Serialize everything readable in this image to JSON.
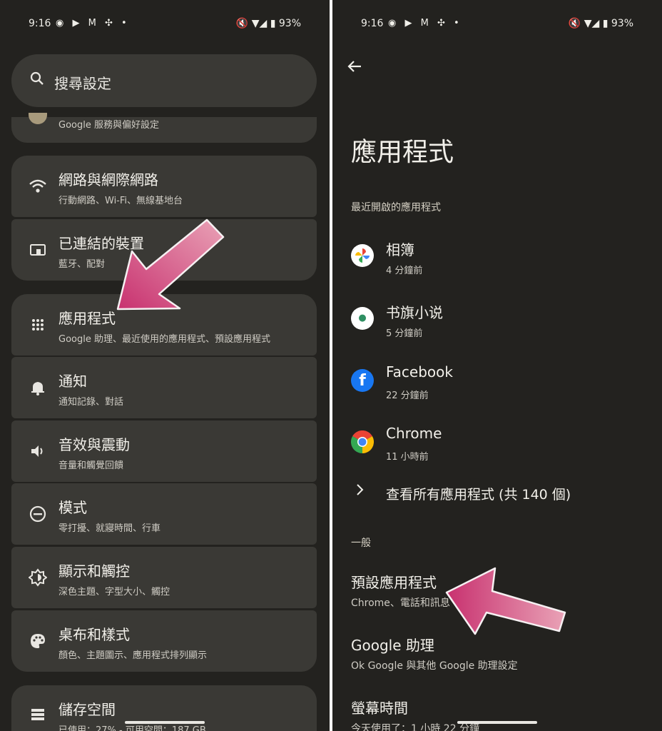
{
  "left": {
    "status": {
      "time": "9:16",
      "apps": "◉ ▶ M ✣ •",
      "system": "🔇 ▼◢ ▮ 93%"
    },
    "search": {
      "placeholder": "搜尋設定"
    },
    "partial_item": {
      "subtitle": "Google 服務與偏好設定"
    },
    "items": [
      {
        "title": "網路與網際網路",
        "subtitle": "行動網路、Wi-Fi、無線基地台",
        "icon": "wifi-icon"
      },
      {
        "title": "已連結的裝置",
        "subtitle": "藍牙、配對",
        "icon": "devices-icon"
      },
      {
        "title": "應用程式",
        "subtitle": "Google 助理、最近使用的應用程式、預設應用程式",
        "icon": "apps-grid-icon"
      },
      {
        "title": "通知",
        "subtitle": "通知記錄、對話",
        "icon": "bell-icon"
      },
      {
        "title": "音效與震動",
        "subtitle": "音量和觸覺回饋",
        "icon": "volume-icon"
      },
      {
        "title": "模式",
        "subtitle": "零打擾、就寢時間、行車",
        "icon": "dnd-icon"
      },
      {
        "title": "顯示和觸控",
        "subtitle": "深色主題、字型大小、觸控",
        "icon": "brightness-icon"
      },
      {
        "title": "桌布和樣式",
        "subtitle": "顏色、主題圖示、應用程式排列顯示",
        "icon": "palette-icon"
      },
      {
        "title": "儲存空間",
        "subtitle": "已使用：27% - 可用空間：187 GB",
        "icon": "storage-icon"
      }
    ]
  },
  "right": {
    "status": {
      "time": "9:16",
      "apps": "◉ ▶ M ✣ •",
      "system": "🔇 ▼◢ ▮ 93%"
    },
    "title": "應用程式",
    "recent_header": "最近開啟的應用程式",
    "recent_apps": [
      {
        "name": "相簿",
        "time": "4 分鐘前",
        "icon": "photos-icon"
      },
      {
        "name": "书旗小说",
        "time": "5 分鐘前",
        "icon": "shuqi-icon"
      },
      {
        "name": "Facebook",
        "time": "22 分鐘前",
        "icon": "facebook-icon"
      },
      {
        "name": "Chrome",
        "time": "11 小時前",
        "icon": "chrome-icon"
      }
    ],
    "see_all": "查看所有應用程式 (共 140 個)",
    "general_header": "一般",
    "general_items": [
      {
        "title": "預設應用程式",
        "subtitle": "Chrome、電話和訊息"
      },
      {
        "title": "Google 助理",
        "subtitle": "Ok Google 與其他 Google 助理設定"
      },
      {
        "title": "螢幕時間",
        "subtitle": "今天使用了：1 小時 22 分鐘"
      }
    ]
  },
  "colors": {
    "background": "#23221f",
    "card": "#3a3935",
    "arrow": "#c8316f"
  }
}
